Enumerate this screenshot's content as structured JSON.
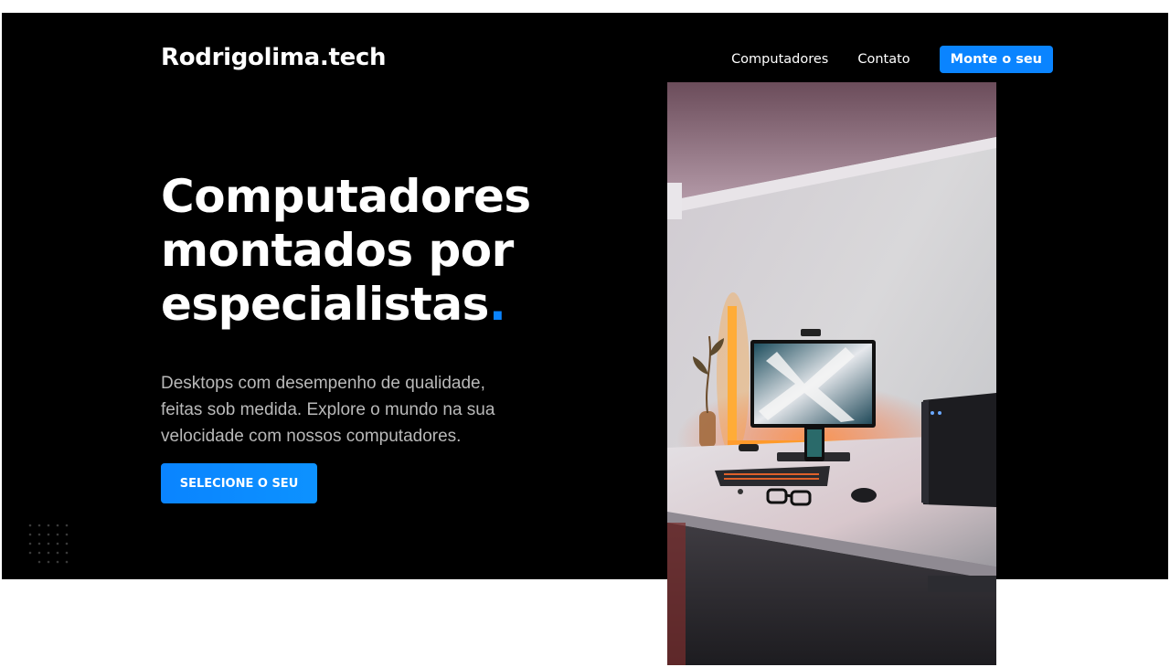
{
  "header": {
    "brand": "Rodrigolima.tech",
    "nav": {
      "link_computers": "Computadores",
      "link_contact": "Contato",
      "cta": "Monte o seu"
    }
  },
  "hero": {
    "title_line1": "Computadores",
    "title_line2": "montados por",
    "title_line3": "especialistas",
    "title_dot": ".",
    "subtitle": "Desktops com desempenho de qualidade, feitas sob medida. Explore o mundo na sua velocidade com nossos computadores.",
    "button": "SELECIONE O SEU"
  },
  "colors": {
    "accent": "#0a84ff",
    "hero_background": "#000000",
    "subtitle_text": "#b9b9b9"
  },
  "image": {
    "alt": "desk-setup-photo"
  }
}
